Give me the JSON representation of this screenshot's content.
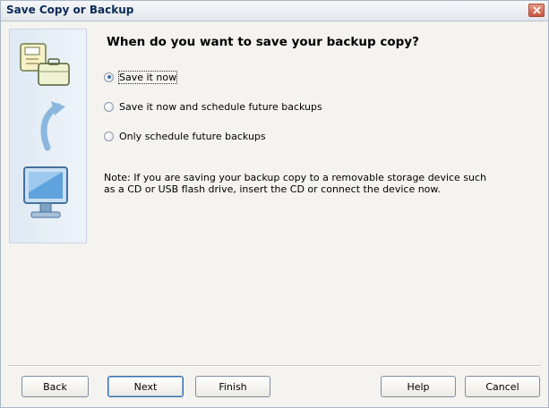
{
  "window": {
    "title": "Save Copy or Backup"
  },
  "content": {
    "heading": "When do you want to save your backup copy?",
    "options": [
      {
        "label": "Save it now",
        "checked": true
      },
      {
        "label": "Save it now and schedule future backups",
        "checked": false
      },
      {
        "label": "Only schedule future backups",
        "checked": false
      }
    ],
    "note_line1": "Note: If you are saving your backup copy to a removable storage device such",
    "note_line2": "as a CD or USB flash drive, insert the CD or connect the device now."
  },
  "buttons": {
    "back": "Back",
    "next": "Next",
    "finish": "Finish",
    "help": "Help",
    "cancel": "Cancel"
  },
  "colors": {
    "title_text": "#0b2a55",
    "close_button": "#c9543c",
    "side_panel": "#dfe9f3"
  },
  "icons": {
    "side_top": "document-briefcase-icon",
    "side_middle": "curved-arrow-icon",
    "side_bottom": "monitor-icon",
    "close": "close-icon"
  }
}
